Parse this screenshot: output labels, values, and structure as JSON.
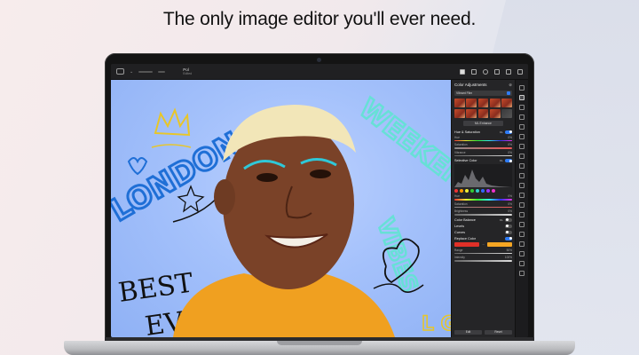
{
  "headline": "The only image editor you'll ever need.",
  "app": {
    "doc_title": "Pol",
    "doc_subtitle": "Edited"
  },
  "canvas_art": {
    "text_london": "LONDON",
    "text_weekend": "WEEKEND",
    "text_vibes": "VIBES",
    "text_best": "BEST",
    "text_ever": "EVER",
    "text_lg": "L G"
  },
  "panel": {
    "title": "Color Adjustments",
    "preset_select": "Vibrant Film",
    "ml_button": "ML Enhance",
    "hue_sat": {
      "label": "Hue & Saturation",
      "badge": "ML",
      "rows": [
        {
          "label": "Hue",
          "value": "0%"
        },
        {
          "label": "Saturation",
          "value": "0%"
        },
        {
          "label": "Vibrance",
          "value": "0%"
        }
      ]
    },
    "selective": {
      "label": "Selective Color",
      "badge": "ML",
      "rows": [
        {
          "label": "Hue",
          "value": "0%"
        },
        {
          "label": "Saturation",
          "value": "0%"
        },
        {
          "label": "Brightness",
          "value": "0%"
        }
      ]
    },
    "sections": [
      {
        "label": "Color Balance",
        "badge": "ML",
        "on": false
      },
      {
        "label": "Levels",
        "badge": "",
        "on": false
      },
      {
        "label": "Curves",
        "badge": "",
        "on": false
      },
      {
        "label": "Replace Color",
        "badge": "",
        "on": true
      }
    ],
    "replace": {
      "from_color": "#e03028",
      "to_color": "#f5a623",
      "range_label": "Range",
      "range_value": "50%",
      "intensity_label": "Intensity",
      "intensity_value": "100%"
    },
    "footer": {
      "left": "Edit",
      "right": "Reset"
    }
  },
  "colors": {
    "accent": "#2f7cf6",
    "canvas_bg": "#a4c1fb",
    "shirt": "#f0a020",
    "ink": "#1f6fd6",
    "neon": "#67e0d6"
  },
  "toolbar_icons": [
    "sidebar-icon",
    "undo-icon",
    "redo-icon",
    "layers-icon",
    "share-icon",
    "settings-icon"
  ],
  "tools": [
    "arrow-icon",
    "adjust-icon",
    "crop-icon",
    "brush-icon",
    "eraser-icon",
    "pen-icon",
    "heal-icon",
    "clone-icon",
    "text-icon",
    "shape-icon",
    "fill-icon",
    "gradient-icon",
    "select-icon",
    "lasso-icon",
    "wand-icon",
    "zoom-icon",
    "hand-icon",
    "eyedropper-icon",
    "blur-icon",
    "sharpen-icon"
  ]
}
